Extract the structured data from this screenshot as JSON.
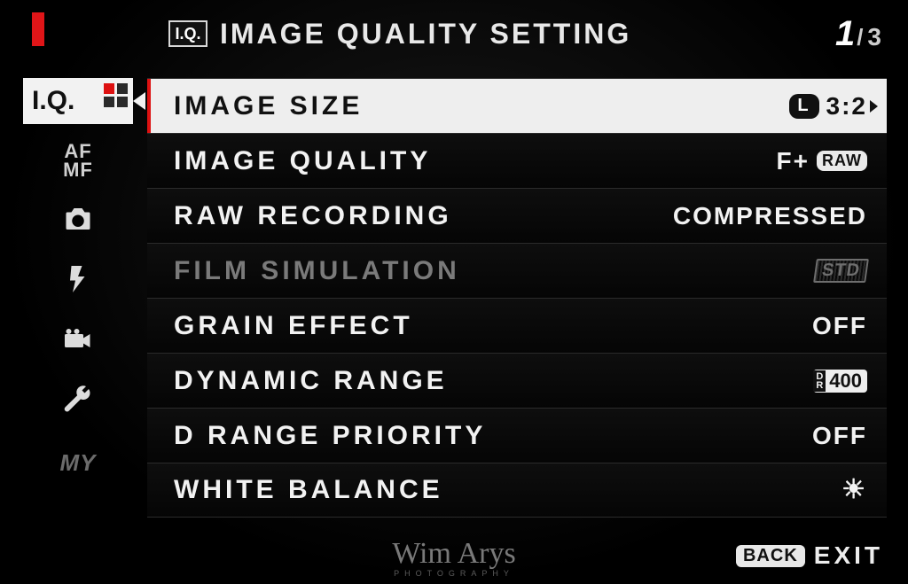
{
  "header": {
    "badge": "I.Q.",
    "title": "IMAGE QUALITY SETTING",
    "page_current": "1",
    "page_sep": "/",
    "page_total": "3"
  },
  "tabs": {
    "iq": "I.Q.",
    "af": "AF",
    "mf": "MF",
    "my": "MY"
  },
  "menu": [
    {
      "label": "IMAGE SIZE",
      "value_badge": "L",
      "value_text": "3:2",
      "selected": true,
      "disabled": false
    },
    {
      "label": "IMAGE QUALITY",
      "value_prefix": "F+",
      "value_raw": "RAW",
      "selected": false,
      "disabled": false
    },
    {
      "label": "RAW RECORDING",
      "value_text": "COMPRESSED",
      "selected": false,
      "disabled": false
    },
    {
      "label": "FILM SIMULATION",
      "value_std": "STD",
      "selected": false,
      "disabled": true
    },
    {
      "label": "GRAIN EFFECT",
      "value_text": "OFF",
      "selected": false,
      "disabled": false
    },
    {
      "label": "DYNAMIC RANGE",
      "value_dr": "400",
      "selected": false,
      "disabled": false
    },
    {
      "label": "D RANGE PRIORITY",
      "value_text": "OFF",
      "selected": false,
      "disabled": false
    },
    {
      "label": "WHITE BALANCE",
      "value_icon": "☀",
      "selected": false,
      "disabled": false
    }
  ],
  "footer": {
    "back": "BACK",
    "exit": "EXIT"
  },
  "watermark": {
    "name": "Wim Arys",
    "sub": "PHOTOGRAPHY"
  }
}
